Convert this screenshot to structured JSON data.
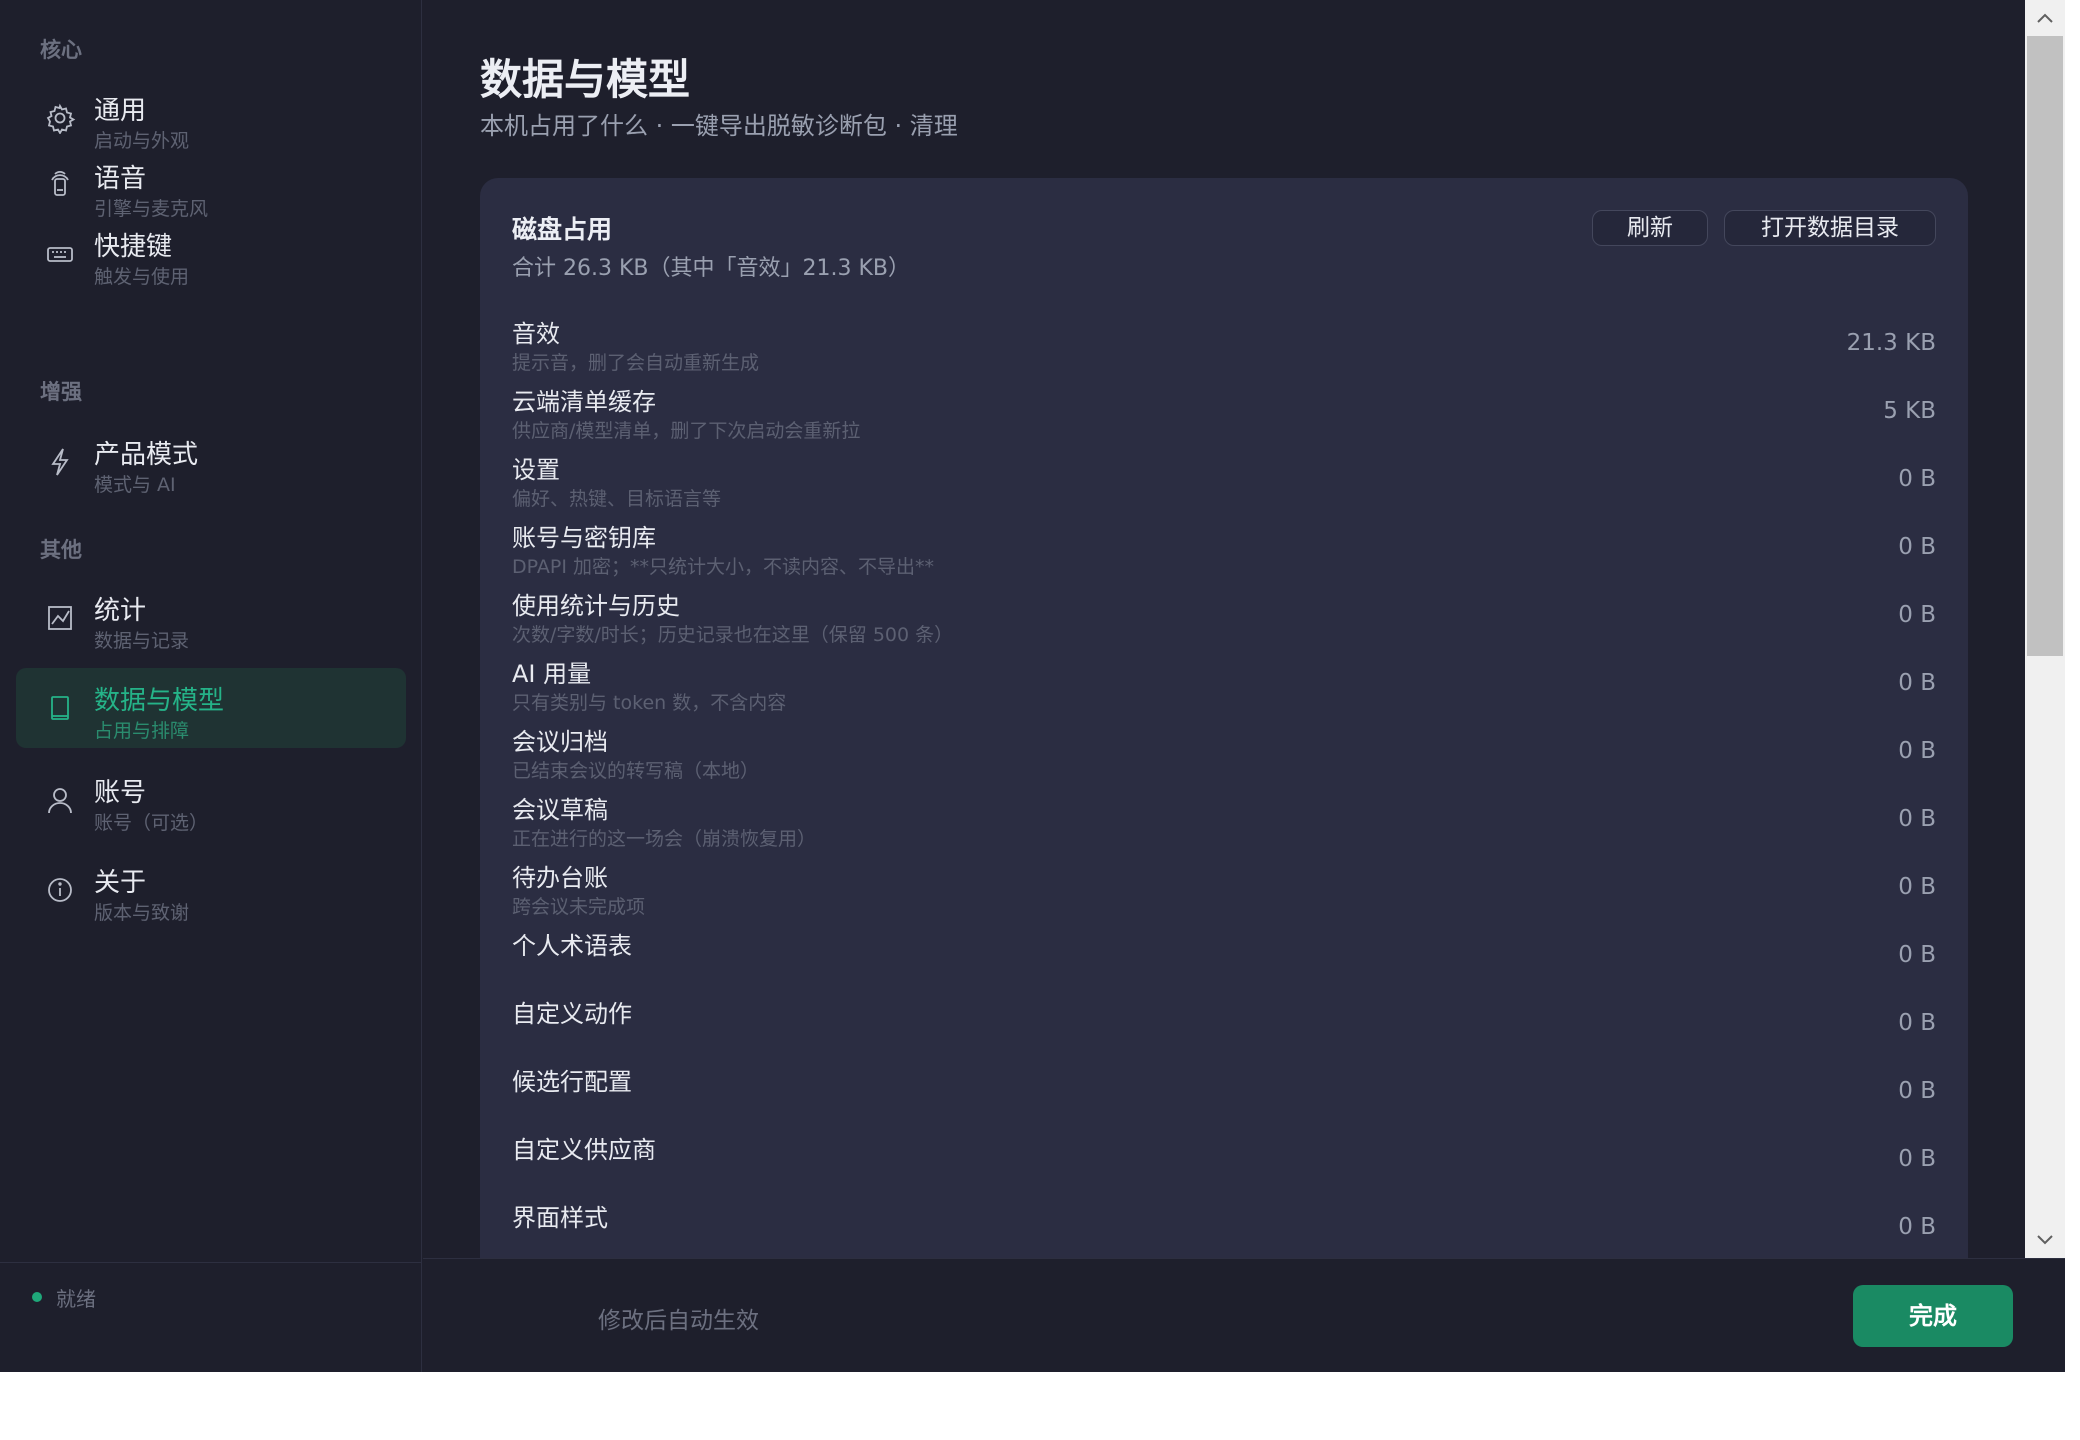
{
  "sidebar": {
    "sections": [
      {
        "label": "核心"
      },
      {
        "label": "增强"
      },
      {
        "label": "其他"
      }
    ],
    "items": [
      {
        "title": "通用",
        "sub": "启动与外观",
        "icon": "gear-icon"
      },
      {
        "title": "语音",
        "sub": "引擎与麦克风",
        "icon": "microphone-icon"
      },
      {
        "title": "快捷键",
        "sub": "触发与使用",
        "icon": "keyboard-icon"
      },
      {
        "title": "产品模式",
        "sub": "模式与 AI",
        "icon": "lightning-icon"
      },
      {
        "title": "统计",
        "sub": "数据与记录",
        "icon": "chart-icon"
      },
      {
        "title": "数据与模型",
        "sub": "占用与排障",
        "icon": "document-icon"
      },
      {
        "title": "账号",
        "sub": "账号（可选）",
        "icon": "user-icon"
      },
      {
        "title": "关于",
        "sub": "版本与致谢",
        "icon": "info-icon"
      }
    ],
    "active_item": "数据与模型",
    "status": "就绪",
    "accent_color": "#25b388"
  },
  "main": {
    "title": "数据与模型",
    "subtitle": "本机占用了什么 · 一键导出脱敏诊断包 · 清理",
    "card": {
      "title": "磁盘占用",
      "summary": "合计 26.3 KB（其中「音效」21.3 KB）",
      "refresh_label": "刷新",
      "open_dir_label": "打开数据目录",
      "rows": [
        {
          "name": "音效",
          "desc": "提示音，删了会自动重新生成",
          "size": "21.3 KB"
        },
        {
          "name": "云端清单缓存",
          "desc": "供应商/模型清单，删了下次启动会重新拉",
          "size": "5 KB"
        },
        {
          "name": "设置",
          "desc": "偏好、热键、目标语言等",
          "size": "0 B"
        },
        {
          "name": "账号与密钥库",
          "desc": "DPAPI 加密；**只统计大小，不读内容、不导出**",
          "size": "0 B"
        },
        {
          "name": "使用统计与历史",
          "desc": "次数/字数/时长；历史记录也在这里（保留 500 条）",
          "size": "0 B"
        },
        {
          "name": "AI 用量",
          "desc": "只有类别与 token 数，不含内容",
          "size": "0 B"
        },
        {
          "name": "会议归档",
          "desc": "已结束会议的转写稿（本地）",
          "size": "0 B"
        },
        {
          "name": "会议草稿",
          "desc": "正在进行的这一场会（崩溃恢复用）",
          "size": "0 B"
        },
        {
          "name": "待办台账",
          "desc": "跨会议未完成项",
          "size": "0 B"
        },
        {
          "name": "个人术语表",
          "desc": "",
          "size": "0 B"
        },
        {
          "name": "自定义动作",
          "desc": "",
          "size": "0 B"
        },
        {
          "name": "候选行配置",
          "desc": "",
          "size": "0 B"
        },
        {
          "name": "自定义供应商",
          "desc": "",
          "size": "0 B"
        },
        {
          "name": "界面样式",
          "desc": "",
          "size": "0 B"
        }
      ]
    }
  },
  "footer": {
    "hint": "修改后自动生效",
    "done_label": "完成",
    "done_color": "#1a8a63"
  }
}
